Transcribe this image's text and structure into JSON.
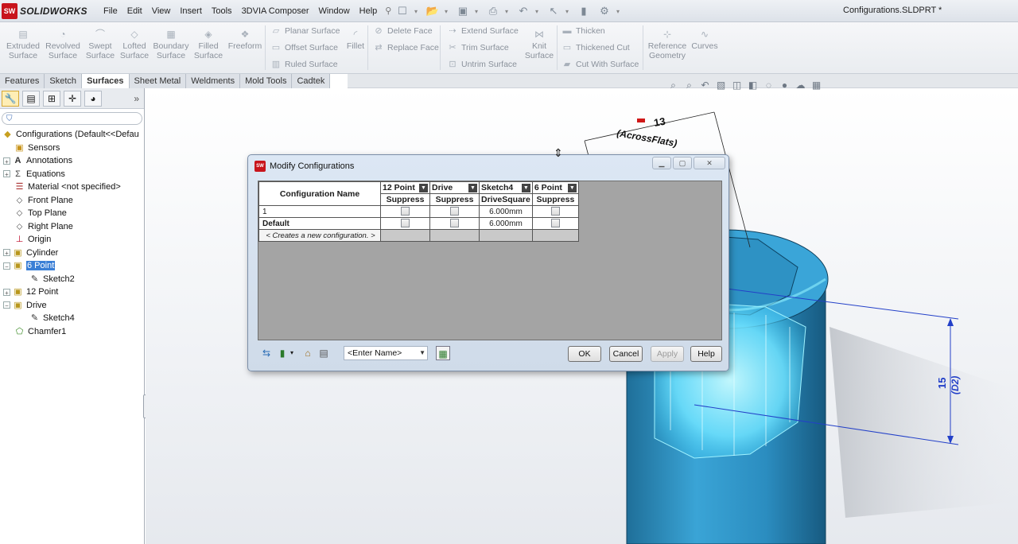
{
  "app": {
    "brand": "SOLIDWORKS",
    "brand_badge": "SW",
    "document_title": "Configurations.SLDPRT *"
  },
  "menu": [
    "File",
    "Edit",
    "View",
    "Insert",
    "Tools",
    "3DVIA Composer",
    "Window",
    "Help"
  ],
  "ribbon": {
    "extruded_surface": "Extruded Surface",
    "revolved_surface": "Revolved Surface",
    "swept_surface": "Swept Surface",
    "lofted_surface": "Lofted Surface",
    "boundary_surface": "Boundary Surface",
    "filled_surface": "Filled Surface",
    "freeform": "Freeform",
    "planar_surface": "Planar Surface",
    "offset_surface": "Offset Surface",
    "ruled_surface": "Ruled Surface",
    "fillet": "Fillet",
    "delete_face": "Delete Face",
    "replace_face": "Replace Face",
    "extend_surface": "Extend Surface",
    "trim_surface": "Trim Surface",
    "untrim_surface": "Untrim Surface",
    "knit_surface": "Knit Surface",
    "thicken": "Thicken",
    "thickened_cut": "Thickened Cut",
    "cut_with_surface": "Cut With Surface",
    "reference_geometry": "Reference Geometry",
    "curves": "Curves"
  },
  "command_tabs": [
    "Features",
    "Sketch",
    "Surfaces",
    "Sheet Metal",
    "Weldments",
    "Mold Tools",
    "Cadtek"
  ],
  "active_tab": "Surfaces",
  "tree": {
    "root": "Configurations  (Default<<Defau",
    "items": [
      {
        "label": "Sensors"
      },
      {
        "label": "Annotations"
      },
      {
        "label": "Equations"
      },
      {
        "label": "Material <not specified>"
      },
      {
        "label": "Front Plane"
      },
      {
        "label": "Top Plane"
      },
      {
        "label": "Right Plane"
      },
      {
        "label": "Origin"
      },
      {
        "label": "Cylinder"
      },
      {
        "label": "6 Point"
      },
      {
        "label": "Sketch2"
      },
      {
        "label": "12 Point"
      },
      {
        "label": "Drive"
      },
      {
        "label": "Sketch4"
      },
      {
        "label": "Chamfer1"
      }
    ]
  },
  "dialog": {
    "title": "Modify Configurations",
    "header_name": "Configuration Name",
    "columns": [
      {
        "name": "12 Point",
        "param": "Suppress"
      },
      {
        "name": "Drive",
        "param": "Suppress"
      },
      {
        "name": "Sketch4",
        "param": "DriveSquare"
      },
      {
        "name": "6 Point",
        "param": "Suppress"
      }
    ],
    "rows": [
      {
        "name": "1",
        "drive_square": "6.000mm"
      },
      {
        "name": "Default",
        "drive_square": "6.000mm"
      }
    ],
    "new_row": "< Creates a new configuration. >",
    "enter_name": "<Enter Name>",
    "buttons": {
      "ok": "OK",
      "cancel": "Cancel",
      "apply": "Apply",
      "help": "Help"
    }
  },
  "annotations": {
    "dim_top_value": "13",
    "dim_top_note": "(AcrossFlats)",
    "dim_side_value": "15",
    "dim_side_name": "(D2)"
  },
  "colors": {
    "brand_red": "#c8141c",
    "model_blue": "#2a8fc4",
    "glow_cyan": "#7fe8ff",
    "selection": "#3a7fd6",
    "dimension_blue": "#2340c8"
  }
}
